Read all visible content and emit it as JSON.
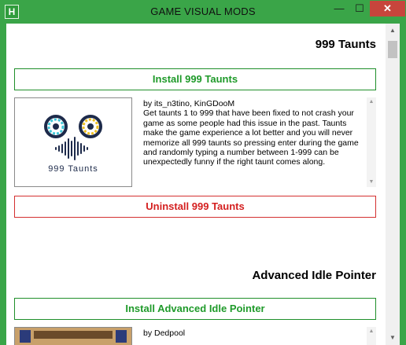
{
  "window": {
    "title": "GAME VISUAL MODS",
    "app_icon_letter": "H",
    "min_glyph": "—",
    "max_glyph": "☐",
    "close_glyph": "✕"
  },
  "mods": [
    {
      "name": "999 Taunts",
      "install_label": "Install 999 Taunts",
      "uninstall_label": "Uninstall 999 Taunts",
      "image_caption": "999 Taunts",
      "description": "by its_n3tino, KinGDooM\nGet taunts 1 to 999 that have been fixed to not crash your game as some people had this issue in the past. Taunts make the game experience a lot better and you will never memorize all 999 taunts so pressing enter during the game and randomly typing a number between 1-999 can be unexpectedly funny if the right taunt comes along."
    },
    {
      "name": "Advanced Idle Pointer",
      "install_label": "Install Advanced Idle Pointer",
      "description": "by Dedpool"
    }
  ],
  "colors": {
    "window_frame": "#3aa548",
    "install_text": "#1f9a2a",
    "uninstall_text": "#d42020"
  }
}
